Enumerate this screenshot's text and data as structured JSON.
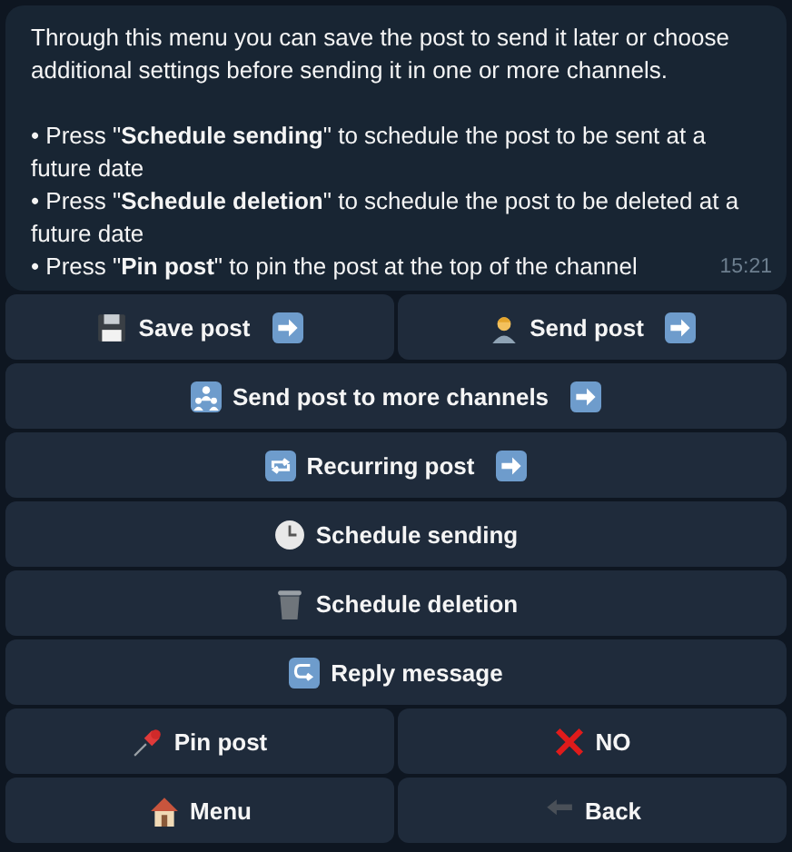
{
  "message": {
    "intro": "Through this menu you can save the post to send it later or choose additional settings before sending it in one or more channels.",
    "bullets": [
      "• Press \"**Schedule sending**\" to schedule the post to be sent at a future date",
      "• Press \"**Schedule deletion**\" to schedule the post to be deleted at a future date",
      "• Press \"**Pin post**\" to pin the post at the top of the channel"
    ],
    "time": "15:21"
  },
  "keyboard": [
    [
      {
        "label": "Save post",
        "kind": "floppy",
        "arrow": true
      },
      {
        "label": "Send post",
        "kind": "person",
        "arrow": true
      }
    ],
    [
      {
        "label": "Send post to more channels",
        "kind": "people",
        "arrow": true
      }
    ],
    [
      {
        "label": "Recurring post",
        "kind": "repeat",
        "arrow": true
      }
    ],
    [
      {
        "label": "Schedule sending",
        "kind": "clock",
        "arrow": false
      }
    ],
    [
      {
        "label": "Schedule deletion",
        "kind": "trash",
        "arrow": false
      }
    ],
    [
      {
        "label": "Reply message",
        "kind": "reply",
        "arrow": false
      }
    ],
    [
      {
        "label": "Pin post",
        "kind": "pin",
        "arrow": false
      },
      {
        "label": "NO",
        "kind": "cross",
        "arrow": false
      }
    ],
    [
      {
        "label": "Menu",
        "kind": "house",
        "arrow": false
      },
      {
        "label": "Back",
        "kind": "back",
        "arrow": false
      }
    ]
  ]
}
